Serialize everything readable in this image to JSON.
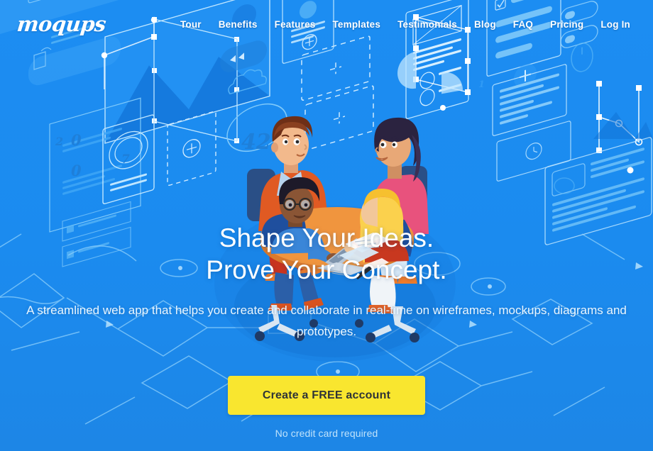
{
  "brand": {
    "logo_text": "moqups",
    "accent_blue": "#1b8bef",
    "accent_yellow": "#f9e62f",
    "text_white": "#ffffff",
    "muted_blue": "#bfe2fb",
    "dark_text": "#2f3437"
  },
  "nav": {
    "items": [
      {
        "label": "Tour"
      },
      {
        "label": "Benefits"
      },
      {
        "label": "Features"
      },
      {
        "label": "Templates"
      },
      {
        "label": "Testimonials"
      },
      {
        "label": "Blog"
      },
      {
        "label": "FAQ"
      },
      {
        "label": "Pricing"
      },
      {
        "label": "Log In"
      }
    ]
  },
  "hero": {
    "headline_line1": "Shape Your Ideas.",
    "headline_line2": "Prove Your Concept.",
    "subheadline": "A streamlined web app that helps you create and collaborate in real-time on wireframes, mockups, diagrams and prototypes.",
    "cta_label": "Create a FREE account",
    "cta_note": "No credit card required"
  },
  "background_art": {
    "badge_number": "42",
    "list_marker": "2",
    "circle_number": "7",
    "step_number": "1",
    "bullet_zero_a": "0",
    "bullet_zero_b": "0"
  }
}
